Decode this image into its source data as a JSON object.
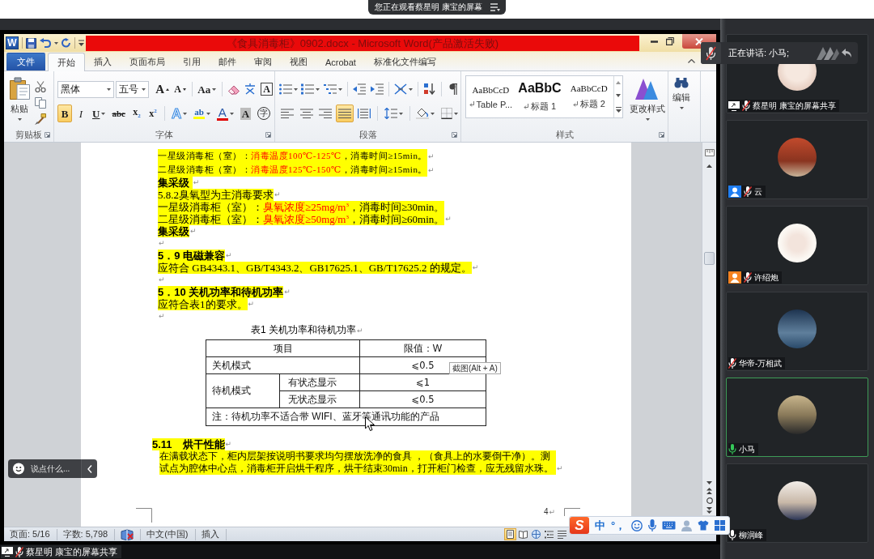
{
  "viewing_banner": {
    "text": "您正在观看蔡星明 康宝的屏幕"
  },
  "word": {
    "app_icon": "W",
    "title": "《食具消毒柜》0902.docx - Microsoft Word(产品激活失败)",
    "tabs": [
      {
        "label": "文件",
        "kind": "file",
        "selected": false
      },
      {
        "label": "开始",
        "kind": "tab",
        "selected": true
      },
      {
        "label": "插入",
        "kind": "tab",
        "selected": false
      },
      {
        "label": "页面布局",
        "kind": "tab",
        "selected": false
      },
      {
        "label": "引用",
        "kind": "tab",
        "selected": false
      },
      {
        "label": "邮件",
        "kind": "tab",
        "selected": false
      },
      {
        "label": "审阅",
        "kind": "tab",
        "selected": false
      },
      {
        "label": "视图",
        "kind": "tab",
        "selected": false
      },
      {
        "label": "Acrobat",
        "kind": "tab",
        "selected": false
      },
      {
        "label": "标准化文件编写",
        "kind": "tab",
        "selected": false
      }
    ],
    "ribbon": {
      "clipboard": {
        "paste": "粘贴",
        "label": "剪贴板"
      },
      "font": {
        "label": "字体",
        "rows": [
          {
            "items": [
              {
                "kind": "font-name",
                "value": "黑体"
              },
              {
                "kind": "font-size",
                "value": "五号"
              },
              {
                "kind": "grow-font",
                "label": "A",
                "selected": false
              },
              {
                "kind": "shrink-font",
                "label": "A",
                "selected": false
              },
              {
                "kind": "separator"
              },
              {
                "kind": "change-case",
                "label": "Aa",
                "selected": false
              },
              {
                "kind": "separator"
              },
              {
                "kind": "clear-format",
                "selected": false
              },
              {
                "kind": "phonetic",
                "selected": false
              },
              {
                "kind": "char-border",
                "label": "A",
                "selected": false
              }
            ]
          },
          {
            "items": [
              {
                "kind": "bold",
                "label": "B",
                "selected": true
              },
              {
                "kind": "italic",
                "label": "I",
                "selected": false
              },
              {
                "kind": "underline",
                "label": "U",
                "selected": false
              },
              {
                "kind": "strike",
                "label": "abc",
                "selected": false
              },
              {
                "kind": "subscript",
                "label": "x$_{2}$",
                "selected": false
              },
              {
                "kind": "superscript",
                "label": "x$^{2}$",
                "selected": false
              },
              {
                "kind": "separator"
              },
              {
                "kind": "text-effect",
                "label": "A",
                "selected": false
              },
              {
                "kind": "highlight",
                "label": "ab",
                "selected": false
              },
              {
                "kind": "font-color",
                "label": "A",
                "selected": false
              },
              {
                "kind": "char-shading",
                "label": "A",
                "selected": false
              },
              {
                "kind": "enclosed-char",
                "label": "字",
                "selected": false
              }
            ]
          }
        ]
      },
      "paragraph": {
        "label": "段落",
        "rows": [
          {
            "items": [
              {
                "kind": "bullets",
                "selected": false
              },
              {
                "kind": "numbering",
                "selected": false
              },
              {
                "kind": "multilevel",
                "selected": false
              },
              {
                "kind": "separator"
              },
              {
                "kind": "decrease-indent",
                "selected": false
              },
              {
                "kind": "increase-indent",
                "selected": false
              },
              {
                "kind": "separator"
              },
              {
                "kind": "chinese-layout",
                "selected": false
              },
              {
                "kind": "separator"
              },
              {
                "kind": "sort",
                "selected": false
              },
              {
                "kind": "separator"
              },
              {
                "kind": "show-marks",
                "selected": false
              }
            ]
          },
          {
            "items": [
              {
                "kind": "align-left",
                "selected": false
              },
              {
                "kind": "align-center",
                "selected": false
              },
              {
                "kind": "align-right",
                "selected": false
              },
              {
                "kind": "justify",
                "selected": true
              },
              {
                "kind": "distribute",
                "selected": false
              },
              {
                "kind": "separator"
              },
              {
                "kind": "line-spacing",
                "selected": false
              },
              {
                "kind": "separator"
              },
              {
                "kind": "para-shading",
                "selected": false
              },
              {
                "kind": "borders",
                "selected": false
              }
            ]
          }
        ]
      },
      "styles": {
        "label": "样式",
        "gallery": [
          {
            "kind": "plain",
            "preview": "AaBbCcD",
            "name": "Table P..."
          },
          {
            "kind": "large",
            "preview": "AaBbC",
            "name": "标题 1"
          },
          {
            "kind": "plain",
            "preview": "AaBbCcD",
            "name": "标题 2"
          }
        ],
        "change": "更改样式"
      },
      "editing": {
        "button": "编辑"
      }
    },
    "document": {
      "blocks": [
        {
          "kind": "small",
          "highlighted": true,
          "runs": [
            {
              "text": "一星级消毒柜（室）：",
              "kind": "plain"
            },
            {
              "text": "消毒温度100℃-125℃",
              "kind": "emphasis"
            },
            {
              "text": "，消毒时间≥15min。",
              "kind": "plain"
            }
          ],
          "mark": "↵"
        },
        {
          "kind": "small",
          "highlighted": true,
          "runs": [
            {
              "text": "二星级消毒柜（室）：",
              "kind": "plain"
            },
            {
              "text": "消毒温度125℃-150℃",
              "kind": "emphasis"
            },
            {
              "text": "，消毒时间≥15min。",
              "kind": "plain"
            }
          ],
          "mark": "↵"
        },
        {
          "kind": "heading",
          "highlighted": true,
          "text": "集采级 ",
          "mark": "↵"
        },
        {
          "kind": "body",
          "highlighted": true,
          "text": "5.8.2臭氧型为主消毒要求",
          "mark": "↵"
        },
        {
          "kind": "body",
          "highlighted": true,
          "runs": [
            {
              "text": "一星级消毒柜（室）：",
              "kind": "plain"
            },
            {
              "text": "臭氧浓度≥25mg/m$^{3}$",
              "kind": "emphasis"
            },
            {
              "text": "，消毒时间≥30min。",
              "kind": "plain"
            }
          ]
        },
        {
          "kind": "body",
          "highlighted": true,
          "runs": [
            {
              "text": "二星级消毒柜（室）：",
              "kind": "plain"
            },
            {
              "text": "臭氧浓度≥50mg/m$^{3}$",
              "kind": "emphasis"
            },
            {
              "text": "，消毒时间≥60min。",
              "kind": "plain"
            }
          ],
          "mark": "↵"
        },
        {
          "kind": "heading",
          "highlighted": true,
          "text": "集采级",
          "mark": "↵"
        },
        {
          "kind": "blank",
          "mark": "↵"
        },
        {
          "kind": "heading",
          "highlighted": true,
          "text": "5．9 电磁兼容",
          "mark": "↵"
        },
        {
          "kind": "body",
          "highlighted": true,
          "text": "应符合 GB4343.1、GB/T4343.2、GB17625.1、GB/T17625.2 的规定。",
          "mark": "↵"
        },
        {
          "kind": "blank",
          "mark": "↵"
        },
        {
          "kind": "heading",
          "highlighted": true,
          "text": "5．10 关机功率和待机功率",
          "mark": "↵"
        },
        {
          "kind": "body",
          "highlighted": true,
          "text": "应符合表1的要求。",
          "mark": "↵"
        },
        {
          "kind": "blank",
          "mark": "↵"
        },
        {
          "kind": "caption",
          "highlighted": false,
          "text": "表1 关机功率和待机功率",
          "mark": "↵"
        },
        {
          "kind": "table",
          "columns": [
            "项目",
            "限值：W"
          ],
          "rows": [
            {
              "item": "关机模式",
              "limit": "⩽0.5"
            },
            {
              "item": "待机模式",
              "subitems": [
                {
                  "item": "有状态显示",
                  "limit": "⩽1"
                },
                {
                  "item": "无状态显示",
                  "limit": "⩽0.5"
                }
              ]
            }
          ],
          "note": "注：待机功率不适合带 WIFI、蓝牙等通讯功能的产品"
        },
        {
          "kind": "section",
          "highlighted": true,
          "text": "5.11　烘干性能",
          "mark": "↵"
        },
        {
          "kind": "indented",
          "highlighted": true,
          "text": "在满载状态下，柜内层架按说明书要求均匀摆放洗净的食具 ，（食具上的水要倒干净）。测试点为腔体中心点，消毒柜开启烘干程序，烘干结束30min，打开柜门检查，应无残留水珠。",
          "mark": "↵"
        }
      ],
      "page_number": {
        "text": "4",
        "mark": "↵"
      }
    },
    "status_bar": {
      "items": [
        {
          "kind": "text",
          "label": "页面: 5/16"
        },
        {
          "kind": "text",
          "label": "字数: 5,798"
        },
        {
          "kind": "proofing"
        },
        {
          "kind": "text",
          "label": "中文(中国)"
        },
        {
          "kind": "text",
          "label": "插入"
        }
      ],
      "views": [
        {
          "kind": "print-layout",
          "selected": true
        },
        {
          "kind": "reading",
          "selected": false
        },
        {
          "kind": "web",
          "selected": false
        },
        {
          "kind": "outline",
          "selected": false
        },
        {
          "kind": "draft",
          "selected": false
        }
      ]
    }
  },
  "share_label": {
    "text": "蔡星明 康宝的屏幕共享",
    "muted": true
  },
  "participants": [
    {
      "name": "蔡星明 康宝的屏幕共享",
      "badge": {
        "kind": "share"
      },
      "muted": true,
      "speaking": false
    },
    {
      "name": "云",
      "badge": {
        "kind": "person",
        "color": "#1f7ef2"
      },
      "muted": true,
      "speaking": false
    },
    {
      "name": "许绍炮",
      "badge": {
        "kind": "person",
        "color": "#f5821f"
      },
      "muted": true,
      "speaking": false
    },
    {
      "name": "华帝-万相武",
      "muted": true,
      "speaking": false
    },
    {
      "name": "小马",
      "muted": false,
      "speaking": true
    },
    {
      "name": "柳润峰",
      "muted": false,
      "speaking": false
    }
  ],
  "speaking_banner": {
    "text": "正在讲话: 小马;",
    "muted": true
  },
  "chat_bar": {
    "placeholder": "说点什么..."
  },
  "ime_toolbar": {
    "logo": "S",
    "items": [
      {
        "kind": "text",
        "label": "中"
      },
      {
        "kind": "text",
        "label": "°，"
      },
      {
        "kind": "emoji"
      },
      {
        "kind": "mic"
      },
      {
        "kind": "keyboard"
      },
      {
        "kind": "user"
      },
      {
        "kind": "shirt"
      },
      {
        "kind": "grid"
      }
    ]
  },
  "screenshot_tooltip": {
    "text": "截图(Alt + A)"
  }
}
